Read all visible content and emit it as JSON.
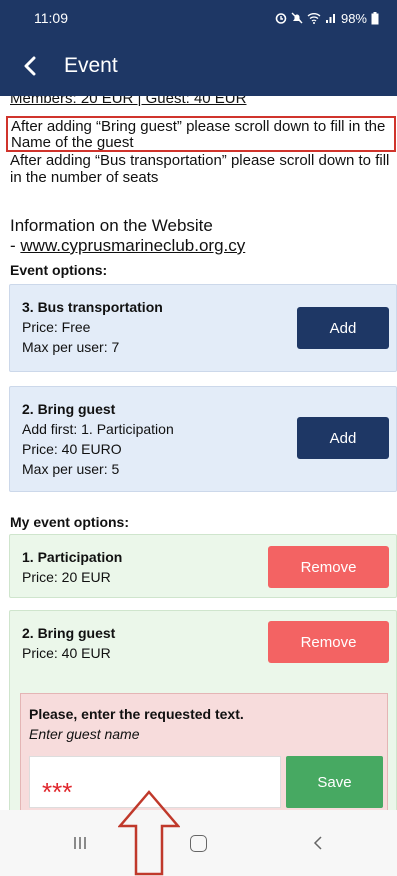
{
  "status_bar": {
    "time": "11:09",
    "icons_text": "98%"
  },
  "app_bar": {
    "back_icon": "back-arrow-icon",
    "title": "Event"
  },
  "content": {
    "cut_line": "Members: 20 EUR | Guest: 40 EUR",
    "notice_1": "After adding “Bring guest” please scroll down to fill in the Name of the guest",
    "notice_2": "After adding “Bus transportation” please scroll down to fill in the number of seats",
    "info_title": "Information on the Website",
    "info_prefix": "- ",
    "info_link": "www.cyprusmarineclub.org.cy",
    "event_options_title": "Event options:",
    "event_options": [
      {
        "name": "3. Bus transportation",
        "line1": "Price: Free",
        "line2": "Max per user: 7",
        "button": "Add"
      },
      {
        "name": "2. Bring guest",
        "line1": "Add first: 1. Participation",
        "line2": "Price: 40 EURO",
        "line3": "Max per user: 5",
        "button": "Add"
      }
    ],
    "my_options_title": "My event options:",
    "my_options": [
      {
        "name": "1. Participation",
        "line1": "Price: 20 EUR",
        "button": "Remove"
      },
      {
        "name": "2. Bring guest",
        "line1": "Price: 40 EUR",
        "button": "Remove"
      }
    ],
    "request": {
      "title": "Please, enter the requested text.",
      "placeholder": "Enter guest name",
      "value": "***",
      "save": "Save"
    }
  },
  "nav_bar": {
    "recents": "|||",
    "home": "home-icon",
    "back": "<"
  },
  "colors": {
    "primary": "#1e3765",
    "remove": "#f36363",
    "save": "#47a962",
    "highlight": "#d0342c"
  }
}
